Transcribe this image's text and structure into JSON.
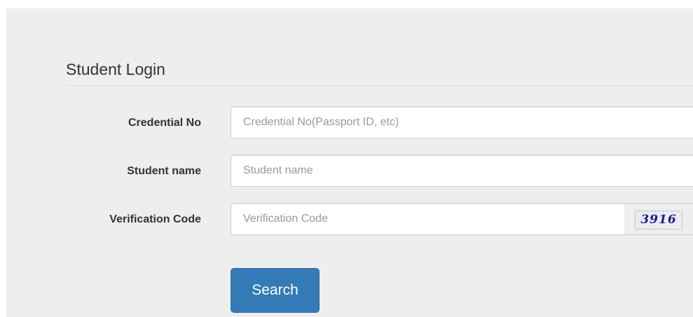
{
  "form": {
    "title": "Student Login",
    "fields": [
      {
        "label": "Credential No",
        "placeholder": "Credential No(Passport ID, etc)",
        "value": ""
      },
      {
        "label": "Student name",
        "placeholder": "Student name",
        "value": ""
      },
      {
        "label": "Verification Code",
        "placeholder": "Verification Code",
        "value": ""
      }
    ],
    "captcha_text": "3916",
    "submit_label": "Search"
  },
  "colors": {
    "panel_bg": "#eeeeee",
    "primary_button": "#337ab7",
    "captcha_text": "#1e1a8c"
  }
}
